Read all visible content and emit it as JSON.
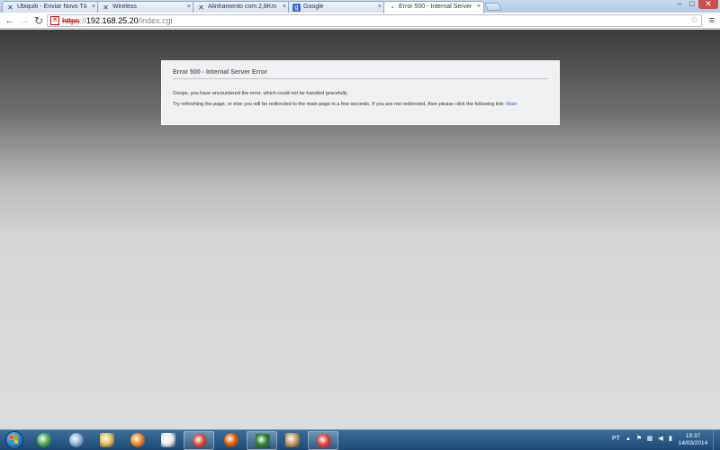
{
  "browser": {
    "tabs": [
      {
        "title": "Ubiquiti - Enviar Novo Tó",
        "icon": "ubiquiti-icon",
        "active": false
      },
      {
        "title": "Wireless",
        "icon": "ubiquiti-icon",
        "active": false
      },
      {
        "title": "Alinhamento com 2,8Km",
        "icon": "ubiquiti-icon",
        "active": false
      },
      {
        "title": "Google",
        "icon": "google-icon",
        "active": false
      },
      {
        "title": "Error 500 - Internal Server",
        "icon": "feed-icon",
        "active": true
      }
    ],
    "close_glyph": "×",
    "window_controls": {
      "minimize": "–",
      "maximize": "□",
      "close": "✕"
    },
    "nav": {
      "back": "←",
      "forward": "→",
      "reload": "↻",
      "menu": "≡"
    },
    "address": {
      "scheme": "https",
      "separator": "://",
      "host": "192.168.25.20",
      "path": "/index.cgi",
      "star": "☆"
    }
  },
  "error_page": {
    "title": "Error 500 - Internal Server Error",
    "message1": "Ooops, you have encountered the error, which could not be handled gracefully.",
    "message2": "Try refreshing the page, or else you will be redirected to the main page in a few seconds. If you are not redirected, then please click the following link:",
    "link_label": "Main"
  },
  "taskbar": {
    "items": [
      {
        "name": "taskbar-chrome-canary-icon",
        "running": false,
        "color": "#4caf50"
      },
      {
        "name": "taskbar-app-circle-icon",
        "running": false,
        "color": "#8fb3d9"
      },
      {
        "name": "taskbar-explorer-icon",
        "running": false,
        "color": "#e8c25a"
      },
      {
        "name": "taskbar-media-player-icon",
        "running": false,
        "color": "#f08a24"
      },
      {
        "name": "taskbar-ghost-app-icon",
        "running": false,
        "color": "#eeeeee"
      },
      {
        "name": "taskbar-chrome-icon",
        "running": true,
        "color": "#db4437"
      },
      {
        "name": "taskbar-firefox-icon",
        "running": false,
        "color": "#e66000"
      },
      {
        "name": "taskbar-winbox-icon",
        "running": true,
        "color": "#2e7d32"
      },
      {
        "name": "taskbar-game-icon",
        "running": false,
        "color": "#c9a063"
      },
      {
        "name": "taskbar-sync-app-icon",
        "running": true,
        "color": "#e53935"
      }
    ],
    "language": "PT",
    "clock_time": "19:37",
    "clock_date": "14/03/2014"
  }
}
